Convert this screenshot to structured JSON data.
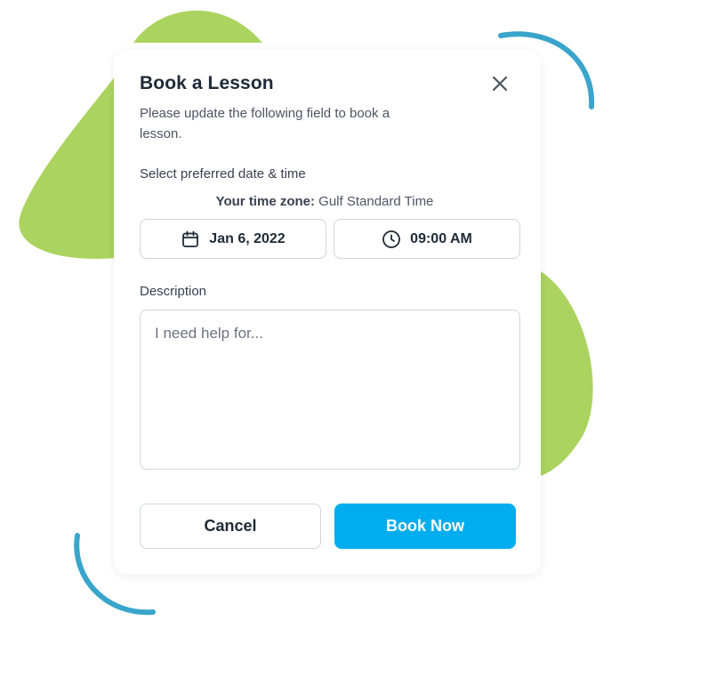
{
  "colors": {
    "accent": "#00adef",
    "decor_green": "#abd35f",
    "decor_blue": "#3aa5cb",
    "title_text": "#1f2a37",
    "border": "#d1d5db"
  },
  "modal": {
    "title": "Book a Lesson",
    "subtitle": "Please update the following field to book a lesson.",
    "close_icon": "close-icon",
    "datetime_label": "Select preferred date & time",
    "timezone_prefix": "Your time zone:",
    "timezone_value": "Gulf Standard Time",
    "date": {
      "icon": "calendar-icon",
      "value": "Jan 6, 2022"
    },
    "time": {
      "icon": "clock-icon",
      "value": "09:00 AM"
    },
    "description_label": "Description",
    "description_placeholder": "I need help for...",
    "description_value": "",
    "cancel_label": "Cancel",
    "book_label": "Book Now"
  }
}
